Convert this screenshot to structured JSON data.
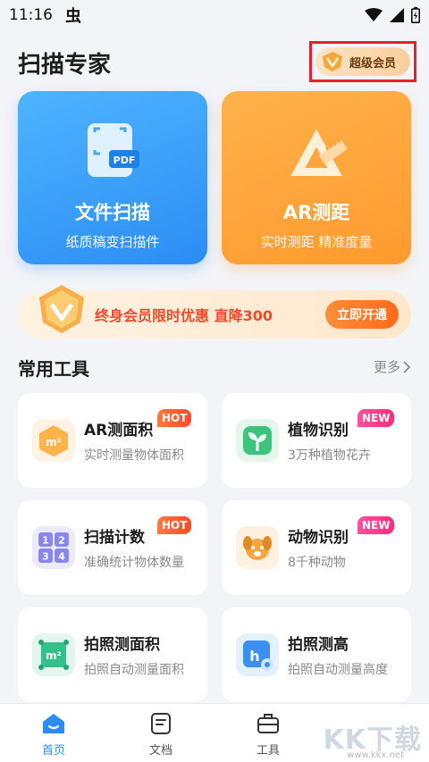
{
  "status_bar": {
    "time": "11:16",
    "app_icon": "虫"
  },
  "header": {
    "title": "扫描专家",
    "vip_label": "超级会员"
  },
  "feature_cards": [
    {
      "title": "文件扫描",
      "subtitle": "纸质稿变扫描件",
      "icon_text": "PDF"
    },
    {
      "title": "AR测距",
      "subtitle": "实时测距 精准度量"
    }
  ],
  "promo": {
    "text": "终身会员限时优惠 直降300",
    "button": "立即开通"
  },
  "tools_section": {
    "title": "常用工具",
    "more": "更多"
  },
  "tools": [
    {
      "name": "AR测面积",
      "desc": "实时测量物体面积",
      "tag": "HOT",
      "icon_text": "m²"
    },
    {
      "name": "植物识别",
      "desc": "3万种植物花卉",
      "tag": "NEW"
    },
    {
      "name": "扫描计数",
      "desc": "准确统计物体数量",
      "tag": "HOT",
      "icon_digits": [
        "1",
        "2",
        "3",
        "4"
      ]
    },
    {
      "name": "动物识别",
      "desc": "8千种动物",
      "tag": "NEW"
    },
    {
      "name": "拍照测面积",
      "desc": "拍照自动测量面积",
      "icon_text": "m²"
    },
    {
      "name": "拍照测高",
      "desc": "拍照自动测量高度",
      "icon_text": "h"
    }
  ],
  "bottom_nav": [
    {
      "label": "首页",
      "active": true
    },
    {
      "label": "文档"
    },
    {
      "label": "工具"
    }
  ],
  "watermark": {
    "main": "KK下载",
    "sub": "www.kkx.net"
  },
  "colors": {
    "accent_blue": "#2b8df4",
    "accent_orange": "#ff9a2e",
    "hot": "#ff4a2a",
    "new": "#ff2e7c"
  }
}
